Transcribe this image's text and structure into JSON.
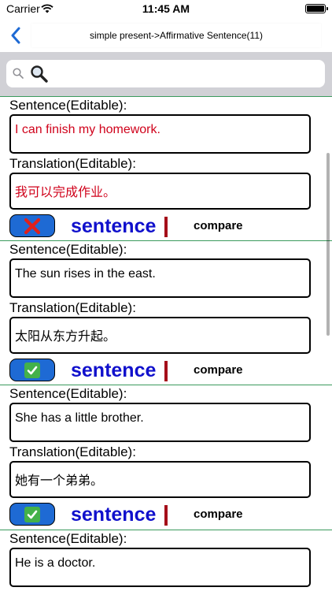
{
  "status_bar": {
    "carrier": "Carrier",
    "time": "11:45 AM"
  },
  "nav": {
    "title": "simple present->Affirmative Sentence(11)"
  },
  "search": {
    "placeholder": "",
    "value": ""
  },
  "labels": {
    "sentence_label": "Sentence(Editable):",
    "translation_label": "Translation(Editable):",
    "sentence_link": "sentence",
    "compare": "compare"
  },
  "entries": [
    {
      "sentence": "I can finish my homework.",
      "translation": "我可以完成作业。",
      "status": "wrong"
    },
    {
      "sentence": "The sun rises in the east.",
      "translation": "太阳从东方升起。",
      "status": "correct"
    },
    {
      "sentence": "She has a little brother.",
      "translation": "她有一个弟弟。",
      "status": "correct"
    },
    {
      "sentence": "He is a doctor.",
      "translation": "",
      "status": ""
    }
  ],
  "colors": {
    "accent_blue": "#1e6ad4",
    "link_blue": "#1010cc",
    "error_red": "#d0021b",
    "separator_green": "#3a9a5c",
    "divider_red": "#a50f1a"
  }
}
